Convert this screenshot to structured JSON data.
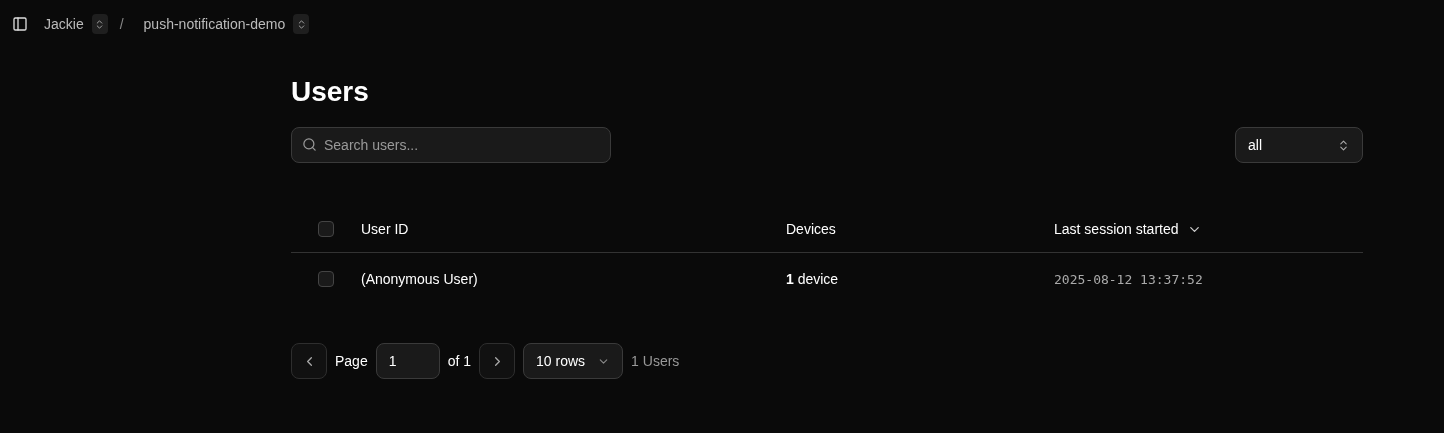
{
  "breadcrumb": [
    {
      "label": "Jackie"
    },
    {
      "label": "push-notification-demo"
    }
  ],
  "separator": "/",
  "title": "Users",
  "search": {
    "placeholder": "Search users..."
  },
  "filter": {
    "value": "all"
  },
  "table": {
    "columns": [
      {
        "label": "User ID",
        "sorted": false
      },
      {
        "label": "Devices",
        "sorted": false
      },
      {
        "label": "Last session started",
        "sorted": true
      }
    ],
    "header_checked": false,
    "rows": [
      {
        "checked": false,
        "user_id": "(Anonymous User)",
        "devices": "**1** device",
        "last_session": "2025-08-12 13:37:52"
      }
    ]
  },
  "pagination": {
    "page_label": "Page",
    "page_value": "1",
    "of_label": "of 1",
    "rows_value": "10 rows",
    "total": "1 Users"
  }
}
